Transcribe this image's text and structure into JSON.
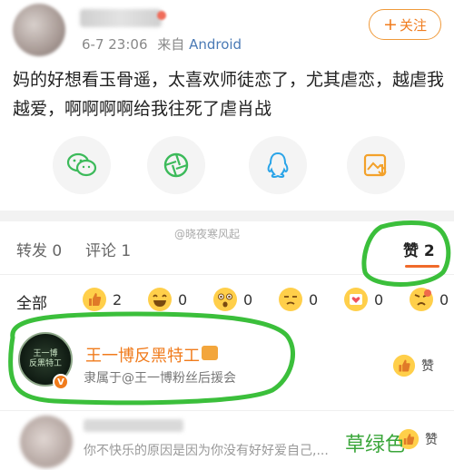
{
  "header": {
    "meta_date": "6-7 23:06",
    "meta_from": "来自",
    "meta_source": "Android",
    "follow_plus": "+",
    "follow_label": "关注"
  },
  "post": {
    "text": "妈的好想看玉骨遥，太喜欢师徒恋了，尤其虐恋，越虐我越爱，啊啊啊啊给我往死了虐肖战"
  },
  "share_icons": [
    "wechat-icon",
    "moments-icon",
    "qq-icon",
    "save-image-icon"
  ],
  "watermark": "@晓夜寒风起",
  "tabs": {
    "repost": "转发 0",
    "comment": "评论 1",
    "like_label": "赞",
    "like_count": "2"
  },
  "reactions": {
    "all_label": "全部",
    "items": [
      {
        "icon": "thumbs-up-icon",
        "count": "2"
      },
      {
        "icon": "laugh-icon",
        "count": "0"
      },
      {
        "icon": "surprised-icon",
        "count": "0"
      },
      {
        "icon": "sad-icon",
        "count": "0"
      },
      {
        "icon": "heart-icon",
        "count": "0"
      },
      {
        "icon": "angry-icon",
        "count": "0"
      }
    ]
  },
  "comment1": {
    "avatar_text_line1": "王一博",
    "avatar_text_line2": "反黑特工",
    "badge": "V",
    "name": "王一博反黑特工",
    "sub": "隶属于@王一博粉丝后援会",
    "like_label": "赞"
  },
  "comment2": {
    "text": "你不快乐的原因是因为你没有好好爱自己,...",
    "like_label": "赞"
  },
  "green_watermark": "草绿色",
  "colors": {
    "accent": "#f07b1c",
    "link": "#4a7ab5",
    "annotation": "#3bbf3b"
  }
}
